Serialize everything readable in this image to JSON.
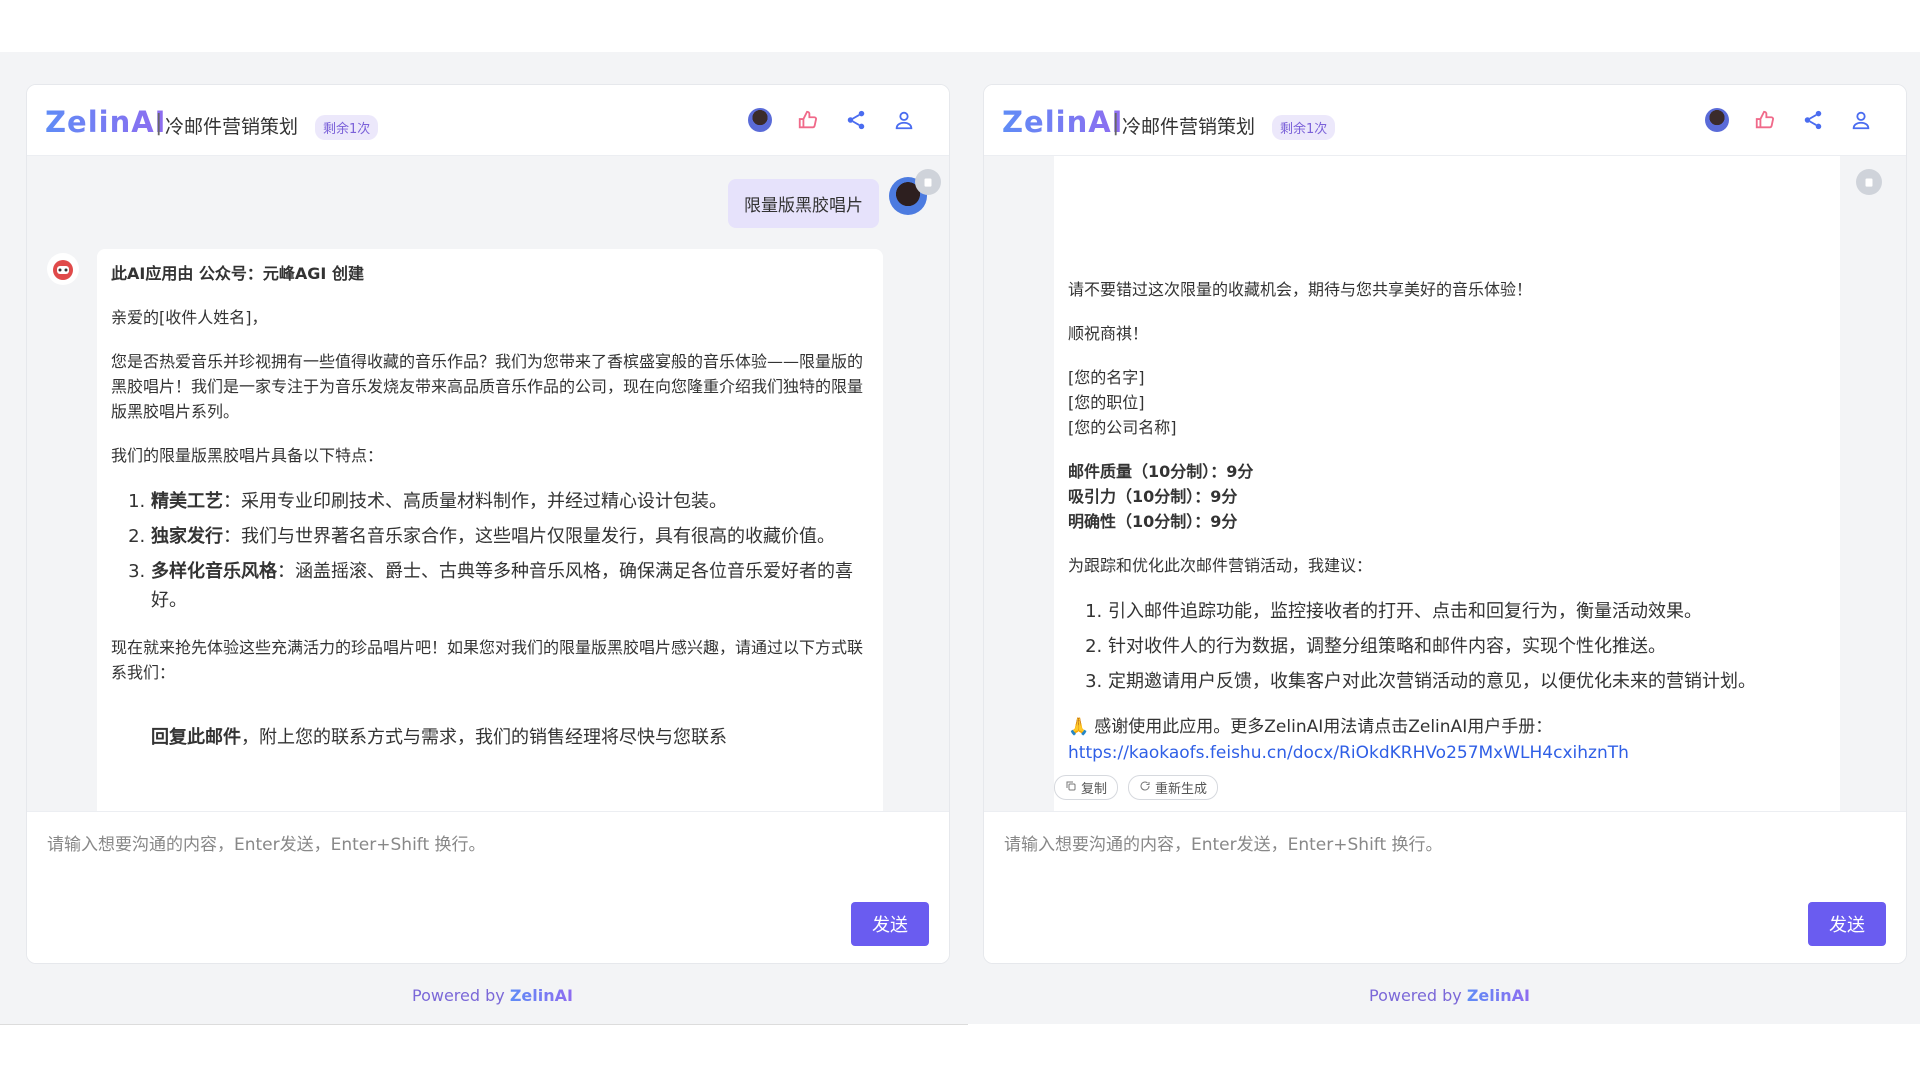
{
  "brand": {
    "logo_text": "ZelinAI",
    "separator": "|",
    "app_title": "冷邮件营销策划",
    "badge": "剩余1次"
  },
  "header_icons": [
    "avatar-icon",
    "thumbs-up-icon",
    "share-icon",
    "user-icon"
  ],
  "colors": {
    "accent": "#6a5cf0",
    "link": "#2f5fe6",
    "user_bubble": "#e6e2fb"
  },
  "left": {
    "user_message": "限量版黑胶唱片",
    "bot": {
      "creator_line": "此AI应用由 公众号：元峰AGI 创建",
      "greeting": "亲爱的[收件人姓名]，",
      "intro": "您是否热爱音乐并珍视拥有一些值得收藏的音乐作品？我们为您带来了香槟盛宴般的音乐体验——限量版的黑胶唱片！我们是一家专注于为音乐发烧友带来高品质音乐作品的公司，现在向您隆重介绍我们独特的限量版黑胶唱片系列。",
      "features_intro": "我们的限量版黑胶唱片具备以下特点：",
      "features": [
        {
          "title": "精美工艺",
          "text": "：采用专业印刷技术、高质量材料制作，并经过精心设计包装。"
        },
        {
          "title": "独家发行",
          "text": "：我们与世界著名音乐家合作，这些唱片仅限量发行，具有很高的收藏价值。"
        },
        {
          "title": "多样化音乐风格",
          "text": "：涵盖摇滚、爵士、古典等多种音乐风格，确保满足各位音乐爱好者的喜好。"
        }
      ],
      "cta": "现在就来抢先体验这些充满活力的珍品唱片吧！如果您对我们的限量版黑胶唱片感兴趣，请通过以下方式联系我们：",
      "contact_title": "回复此邮件",
      "contact_text": "，附上您的联系方式与需求，我们的销售经理将尽快与您联系"
    }
  },
  "right": {
    "bot": {
      "closing": "请不要错过这次限量的收藏机会，期待与您共享美好的音乐体验！",
      "regards": "顺祝商祺！",
      "sig_name": "[您的名字]",
      "sig_title": "[您的职位]",
      "sig_company": "[您的公司名称]",
      "scores": [
        "邮件质量（10分制）：9分",
        "吸引力（10分制）：9分",
        "明确性（10分制）：9分"
      ],
      "suggest_intro": "为跟踪和优化此次邮件营销活动，我建议：",
      "suggestions": [
        "引入邮件追踪功能，监控接收者的打开、点击和回复行为，衡量活动效果。",
        "针对收件人的行为数据，调整分组策略和邮件内容，实现个性化推送。",
        "定期邀请用户反馈，收集客户对此次营销活动的意见，以便优化未来的营销计划。"
      ],
      "thanks_emoji": "🙏",
      "thanks_text": "感谢使用此应用。更多ZelinAI用法请点击ZelinAI用户手册：",
      "link_text": "https://kaokaofs.feishu.cn/docx/RiOkdKRHVo257MxWLH4cxihznTh"
    },
    "actions": {
      "copy": "复制",
      "regenerate": "重新生成"
    }
  },
  "input": {
    "placeholder": "请输入想要沟通的内容，Enter发送，Enter+Shift 换行。",
    "send": "发送"
  },
  "footer": {
    "powered_prefix": "Powered by ",
    "powered_brand": "ZelinAI"
  }
}
